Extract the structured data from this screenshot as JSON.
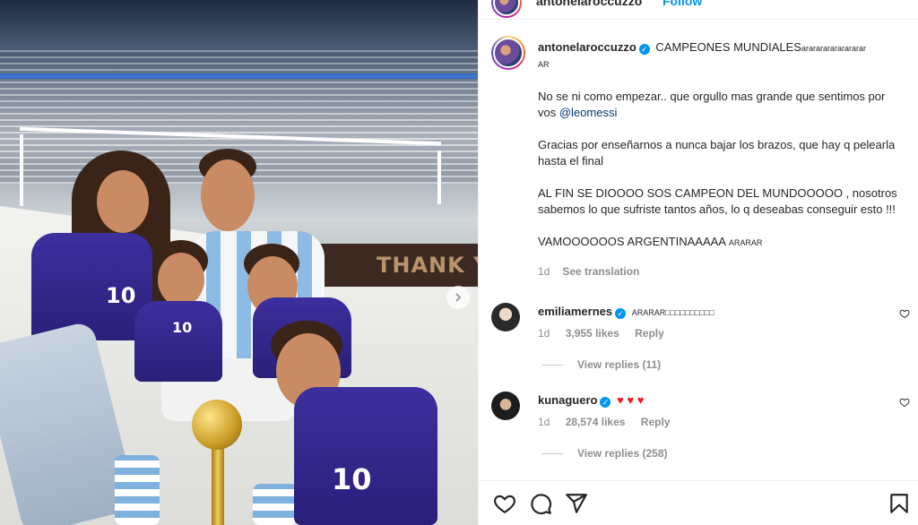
{
  "post": {
    "username": "antonelaroccuzzo",
    "follow_label": "Follow",
    "photo_banner": "THANK Y",
    "jersey_numbers": [
      "10",
      "10",
      "10"
    ]
  },
  "caption": {
    "username": "antonelaroccuzzo",
    "title": "CAMPEONES MUNDIALES",
    "title_suffix": "ararararararararar",
    "title_suffix_tail": "AR",
    "p1": "No se ni como empezar.. que orgullo mas grande que sentimos por vos ",
    "p1_mention": "@leomessi",
    "p2": "Gracias por enseñarnos a nunca bajar los brazos, que hay q pelearla hasta el final",
    "p3": "AL FIN SE DIOOOO SOS CAMPEON DEL MUNDOOOOO , nosotros sabemos lo que sufriste tantos años, lo q deseabas conseguir esto !!!",
    "p4": "VAMOOOOOOS ARGENTINAAAAA",
    "p4_suffix": "ARARAR",
    "time": "1d",
    "see_translation": "See translation"
  },
  "comments": [
    {
      "username": "emiliamernes",
      "text": "ARARAR□□□□□□□□□□",
      "time": "1d",
      "likes": "3,955 likes",
      "reply": "Reply",
      "view_replies": "View replies (11)"
    },
    {
      "username": "kunaguero",
      "text": "♥ ♥ ♥",
      "time": "1d",
      "likes": "28,574 likes",
      "reply": "Reply",
      "view_replies": "View replies (258)"
    }
  ],
  "icons": {
    "like": "heart-icon",
    "comment": "comment-icon",
    "share": "share-icon",
    "save": "bookmark-icon",
    "verified": "verified-badge-icon",
    "carousel_next": "chevron-right-icon"
  },
  "colors": {
    "link": "#00376b",
    "accent": "#0095f6",
    "muted": "#8e8e8e",
    "heart_red": "#ed1c24"
  }
}
